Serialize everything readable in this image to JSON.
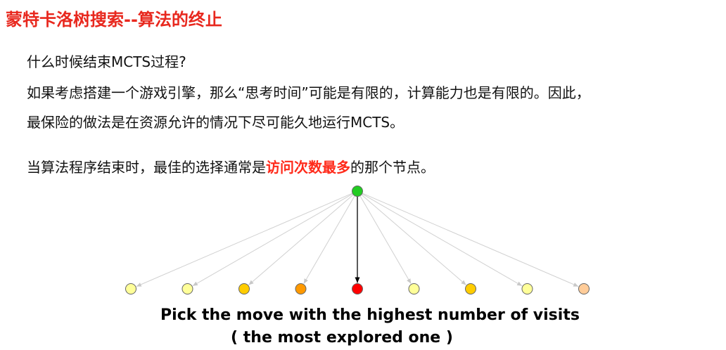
{
  "title": "蒙特卡洛树搜索--算法的终止",
  "paragraphs": {
    "question": "什么时候结束MCTS过程?",
    "line2": "如果考虑搭建一个游戏引擎，那么“思考时间”可能是有限的，计算能力也是有限的。因此，",
    "line3": "最保险的做法是在资源允许的情况下尽可能久地运行MCTS。",
    "line4_before": "当算法程序结束时，最佳的选择通常是",
    "line4_highlight": "访问次数最多",
    "line4_after": "的那个节点。"
  },
  "tree": {
    "root_color": "#22cc22",
    "chosen_child_index": 4,
    "children_colors": [
      "#ffff99",
      "#ffff99",
      "#ffcc00",
      "#ff9900",
      "#ff0000",
      "#ffff99",
      "#ffcc00",
      "#ffff99",
      "#ffcc99"
    ],
    "edge_color_default": "#d0d0d0",
    "edge_color_chosen": "#000000"
  },
  "caption": {
    "line1": "Pick the move with the highest number of visits",
    "line2": "( the most explored one )"
  }
}
